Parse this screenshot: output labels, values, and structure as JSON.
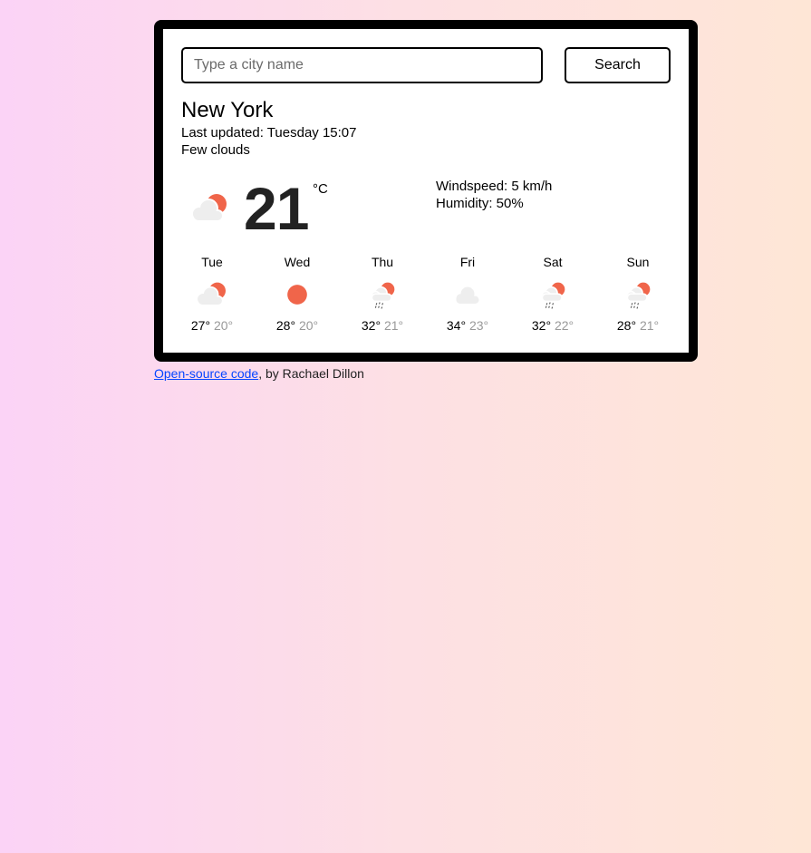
{
  "search": {
    "placeholder": "Type a city name",
    "value": "",
    "button_label": "Search"
  },
  "current": {
    "city": "New York",
    "last_updated": "Last updated: Tuesday 15:07",
    "description": "Few clouds",
    "icon": "few-clouds-icon",
    "temperature": "21",
    "unit": "°C",
    "windspeed": "Windspeed: 5 km/h",
    "humidity": "Humidity: 50%"
  },
  "forecast": [
    {
      "day": "Tue",
      "icon": "few-clouds",
      "max": "27°",
      "min": "20°"
    },
    {
      "day": "Wed",
      "icon": "clear-sky",
      "max": "28°",
      "min": "20°"
    },
    {
      "day": "Thu",
      "icon": "rain",
      "max": "32°",
      "min": "21°"
    },
    {
      "day": "Fri",
      "icon": "clouds",
      "max": "34°",
      "min": "23°"
    },
    {
      "day": "Sat",
      "icon": "rain",
      "max": "32°",
      "min": "22°"
    },
    {
      "day": "Sun",
      "icon": "rain",
      "max": "28°",
      "min": "21°"
    }
  ],
  "footer": {
    "link_text": "Open-source code",
    "suffix": ", by Rachael Dillon"
  },
  "colors": {
    "sun": "#f0654a",
    "cloud": "#eeeeee",
    "rain": "#555555",
    "link": "#0645ff"
  }
}
